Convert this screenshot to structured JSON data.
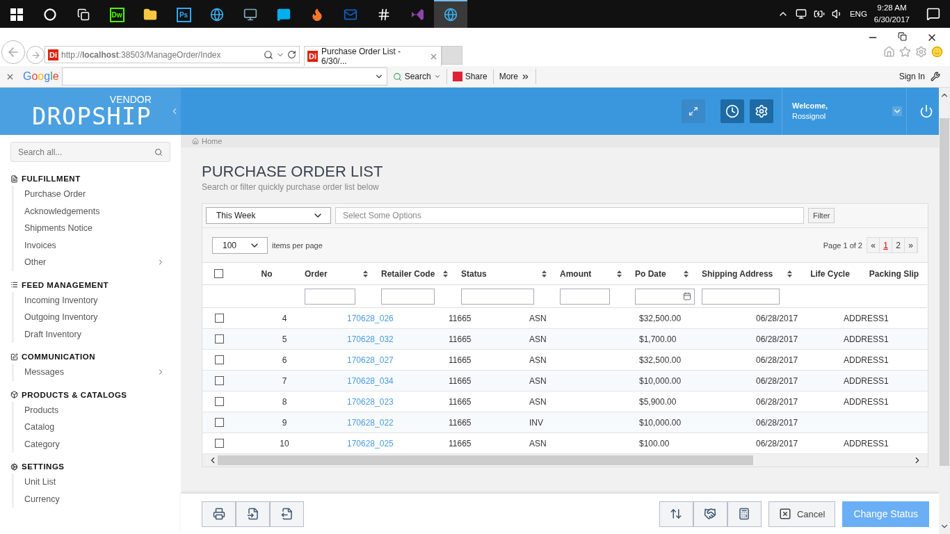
{
  "taskbar": {
    "apps": [
      {
        "kind": "windows",
        "selected": false
      },
      {
        "kind": "cortana",
        "selected": false
      },
      {
        "kind": "taskview",
        "selected": false
      },
      {
        "kind": "tile",
        "label": "Dw",
        "color": "#4cff00",
        "selected": false
      },
      {
        "kind": "folder",
        "selected": false
      },
      {
        "kind": "tile",
        "label": "Ps",
        "color": "#31a8ff",
        "selected": false
      },
      {
        "kind": "ie",
        "selected": false
      },
      {
        "kind": "remote",
        "selected": false
      },
      {
        "kind": "skype",
        "selected": false
      },
      {
        "kind": "firefox",
        "selected": false
      },
      {
        "kind": "outlook",
        "selected": false
      },
      {
        "kind": "slack",
        "selected": false
      },
      {
        "kind": "studio",
        "selected": false
      },
      {
        "kind": "ie",
        "selected": true
      }
    ],
    "language": "ENG",
    "time": "9:28 AM",
    "date": "6/30/2017"
  },
  "browser": {
    "favicon": "Di",
    "address": "http://**localhost**:38503/ManageOrder/Index",
    "tab": {
      "favicon": "Di",
      "title": "Purchase Order List - 6/30/..."
    },
    "google_bar": {
      "logo": "Google",
      "search": "Search",
      "share": "Share",
      "more": "More",
      "sign_in": "Sign In"
    }
  },
  "header": {
    "brand_small": "VENDOR",
    "brand": "DROPSHIP",
    "welcome": "Welcome,",
    "user": "Rossignol"
  },
  "sidebar": {
    "search": {
      "placeholder": "Search all..."
    },
    "sections": [
      {
        "title": "FULFILLMENT",
        "kind": "document",
        "items": [
          {
            "label": "Purchase Order",
            "has_submenu": false
          },
          {
            "label": "Acknowledgements",
            "has_submenu": false
          },
          {
            "label": "Shipments Notice",
            "has_submenu": false
          },
          {
            "label": "Invoices",
            "has_submenu": false
          },
          {
            "label": "Other",
            "has_submenu": true
          }
        ]
      },
      {
        "title": "FEED MANAGEMENT",
        "kind": "list",
        "items": [
          {
            "label": "Incoming Inventory",
            "has_submenu": false
          },
          {
            "label": "Outgoing Inventory",
            "has_submenu": false
          },
          {
            "label": "Draft Inventory",
            "has_submenu": false
          }
        ]
      },
      {
        "title": "COMMUNICATION",
        "kind": "edit",
        "items": [
          {
            "label": "Messages",
            "has_submenu": true
          }
        ]
      },
      {
        "title": "PRODUCTS & CATALOGS",
        "kind": "box",
        "items": [
          {
            "label": "Products",
            "has_submenu": false
          },
          {
            "label": "Catalog",
            "has_submenu": false
          },
          {
            "label": "Category",
            "has_submenu": false
          }
        ]
      },
      {
        "title": "SETTINGS",
        "kind": "gear",
        "items": [
          {
            "label": "Unit List",
            "has_submenu": false
          },
          {
            "label": "Currency",
            "has_submenu": false
          }
        ]
      }
    ]
  },
  "breadcrumb": "Home",
  "page": {
    "title": "PURCHASE ORDER LIST",
    "subtitle": "Search or filter quickly purchase order list below"
  },
  "filter": {
    "period": "This Week",
    "options_placeholder": "Select Some Options",
    "button": "Filter"
  },
  "paging": {
    "per_page": "100",
    "per_page_label": "items per page",
    "summary": "Page 1 of 2",
    "pages": [
      {
        "label": "«",
        "selected": false
      },
      {
        "label": "1",
        "selected": true
      },
      {
        "label": "2",
        "selected": false
      },
      {
        "label": "»",
        "selected": false
      }
    ]
  },
  "table": {
    "all_checked": false,
    "columns": [
      {
        "label": "No",
        "sortable": false,
        "kind": "plain"
      },
      {
        "label": "Order",
        "sortable": true,
        "kind": "text"
      },
      {
        "label": "Retailer Code",
        "sortable": true,
        "kind": "text"
      },
      {
        "label": "Status",
        "sortable": true,
        "kind": "text"
      },
      {
        "label": "Amount",
        "sortable": true,
        "kind": "text"
      },
      {
        "label": "Po Date",
        "sortable": true,
        "kind": "date"
      },
      {
        "label": "Shipping Address",
        "sortable": true,
        "kind": "text"
      },
      {
        "label": "Life Cycle",
        "sortable": false,
        "kind": "plain"
      },
      {
        "label": "Packing Slip",
        "sortable": false,
        "kind": "plain"
      }
    ],
    "rows": [
      {
        "checked": false,
        "no": "4",
        "order": "170628_026",
        "retailer": "11665",
        "status": "ASN",
        "amount": "$32,500.00",
        "date": "06/28/2017",
        "address": "ADDRESS1"
      },
      {
        "checked": false,
        "no": "5",
        "order": "170628_032",
        "retailer": "11665",
        "status": "ASN",
        "amount": "$1,700.00",
        "date": "06/28/2017",
        "address": "ADDRESS1"
      },
      {
        "checked": false,
        "no": "6",
        "order": "170628_027",
        "retailer": "11665",
        "status": "ASN",
        "amount": "$32,500.00",
        "date": "06/28/2017",
        "address": "ADDRESS1"
      },
      {
        "checked": false,
        "no": "7",
        "order": "170628_034",
        "retailer": "11665",
        "status": "ASN",
        "amount": "$10,000.00",
        "date": "06/28/2017",
        "address": "ADDRESS1"
      },
      {
        "checked": false,
        "no": "8",
        "order": "170628_023",
        "retailer": "11665",
        "status": "ASN",
        "amount": "$5,900.00",
        "date": "06/28/2017",
        "address": "ADDRESS1"
      },
      {
        "checked": false,
        "no": "9",
        "order": "170628_022",
        "retailer": "11665",
        "status": "INV",
        "amount": "$10,000.00",
        "date": "06/28/2017"
      },
      {
        "checked": false,
        "no": "10",
        "order": "170628_025",
        "retailer": "11665",
        "status": "ASN",
        "amount": "$100.00",
        "date": "06/28/2017",
        "address": "ADDRESS1"
      }
    ]
  },
  "actions": {
    "left": [
      {
        "kind": "print"
      },
      {
        "kind": "import"
      },
      {
        "kind": "export"
      }
    ],
    "right": [
      {
        "kind": "transfer"
      },
      {
        "kind": "handshake"
      },
      {
        "kind": "invoice"
      }
    ],
    "cancel": "Cancel",
    "primary": "Change Status"
  }
}
